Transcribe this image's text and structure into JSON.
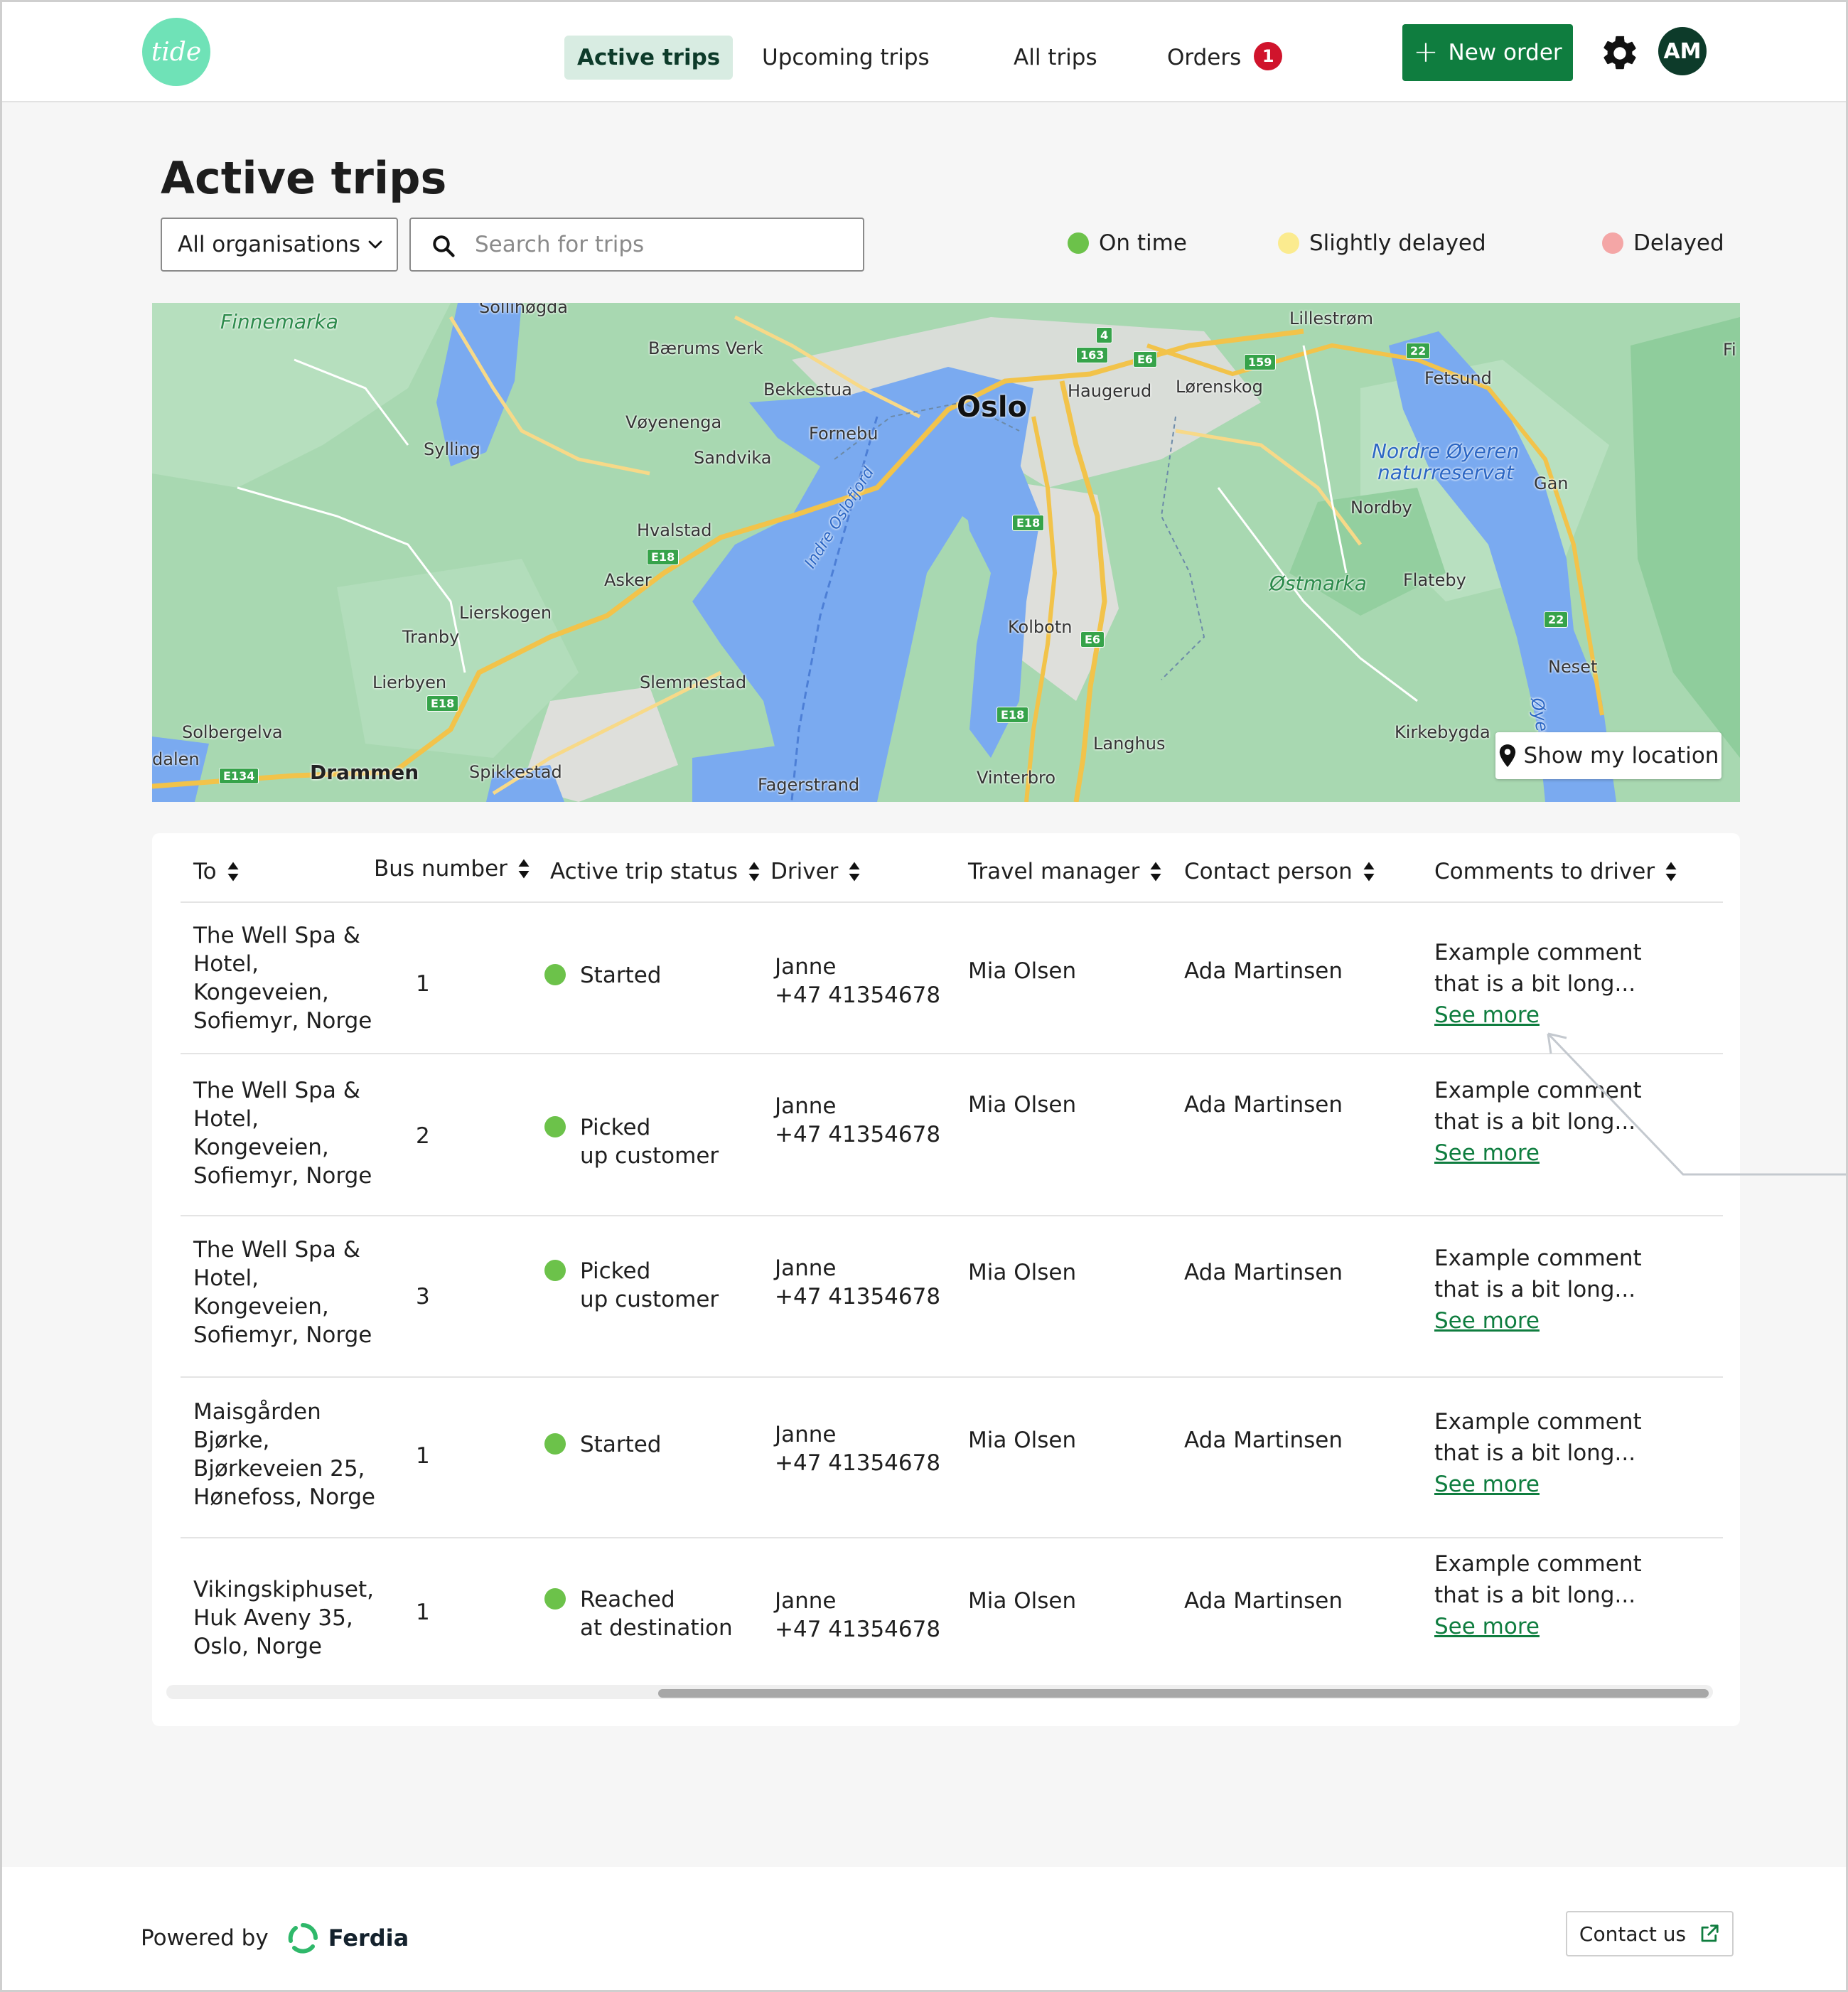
{
  "app": {
    "logo_text": "tide"
  },
  "nav": {
    "active_trips": "Active trips",
    "upcoming_trips": "Upcoming trips",
    "all_trips": "All trips",
    "orders": "Orders",
    "orders_badge": "1"
  },
  "header": {
    "new_order": "New order",
    "avatar_initials": "AM"
  },
  "page": {
    "title": "Active trips"
  },
  "filters": {
    "organisation_selected": "All organisations",
    "search_placeholder": "Search for trips"
  },
  "legend": {
    "on_time": "On time",
    "slightly_delayed": "Slightly delayed",
    "delayed": "Delayed",
    "colors": {
      "on_time": "#6cc24a",
      "slightly_delayed": "#fbeb8f",
      "delayed": "#f4a6a6"
    }
  },
  "map": {
    "show_location": "Show my location",
    "labels": {
      "finnemarka": "Finnemarka",
      "sollihogda": "Sollihøgda",
      "baerums_verk": "Bærums Verk",
      "lillestrom": "Lillestrøm",
      "fetsund": "Fetsund",
      "bekkestua": "Bekkestua",
      "oslo": "Oslo",
      "haugerud": "Haugerud",
      "lorenskog": "Lørenskog",
      "voyenenga": "Vøyenenga",
      "fornebu": "Fornebu",
      "sylling": "Sylling",
      "sandvika": "Sandvika",
      "nordre_oyeren": "Nordre Øyeren",
      "naturreservat": "naturreservat",
      "gan": "Gan",
      "nordby": "Nordby",
      "hvalstad": "Hvalstad",
      "indre_oslofjord": "Indre Oslofjord",
      "asker": "Asker",
      "ostmarka": "Østmarka",
      "flateby": "Flateby",
      "lierskogen": "Lierskogen",
      "tranby": "Tranby",
      "kolbotn": "Kolbotn",
      "neset": "Neset",
      "slemmestad": "Slemmestad",
      "lierbyen": "Lierbyen",
      "solbergelva": "Solbergelva",
      "kirkebygda": "Kirkebygda",
      "langhus": "Langhus",
      "dalen": "dalen",
      "drammen": "Drammen",
      "spikkestad": "Spikkestad",
      "fagerstrand": "Fagerstrand",
      "vinterbro": "Vinterbro",
      "oyeren": "Øyer",
      "fi": "Fi"
    },
    "shields": {
      "r4": "4",
      "r163": "163",
      "e6a": "E6",
      "r159": "159",
      "r22a": "22",
      "e18a": "E18",
      "e18b": "E18",
      "e18c": "E18",
      "e18d": "E18",
      "e6b": "E6",
      "r22b": "22",
      "e134": "E134"
    }
  },
  "table": {
    "headers": {
      "to": "To",
      "bus_number": "Bus number",
      "status": "Active trip status",
      "driver": "Driver",
      "travel_manager": "Travel manager",
      "contact_person": "Contact person",
      "comments": "Comments to driver"
    },
    "rows": [
      {
        "to": [
          "The Well Spa &",
          "Hotel,",
          "Kongeveien,",
          "Sofiemyr, Norge"
        ],
        "bus": "1",
        "status": [
          "Started"
        ],
        "driver_name": "Janne",
        "driver_phone": "+47 41354678",
        "travel_manager": "Mia Olsen",
        "contact_person": "Ada Martinsen",
        "comment": [
          "Example comment",
          "that is a bit long..."
        ],
        "see_more": "See more"
      },
      {
        "to": [
          "The Well Spa &",
          "Hotel,",
          "Kongeveien,",
          "Sofiemyr, Norge"
        ],
        "bus": "2",
        "status": [
          "Picked",
          "up customer"
        ],
        "driver_name": "Janne",
        "driver_phone": "+47 41354678",
        "travel_manager": "Mia Olsen",
        "contact_person": "Ada Martinsen",
        "comment": [
          "Example comment",
          "that is a bit long..."
        ],
        "see_more": "See more"
      },
      {
        "to": [
          "The Well Spa &",
          "Hotel,",
          "Kongeveien,",
          "Sofiemyr, Norge"
        ],
        "bus": "3",
        "status": [
          "Picked",
          "up customer"
        ],
        "driver_name": "Janne",
        "driver_phone": "+47 41354678",
        "travel_manager": "Mia Olsen",
        "contact_person": "Ada Martinsen",
        "comment": [
          "Example comment",
          "that is a bit long..."
        ],
        "see_more": "See more"
      },
      {
        "to": [
          "Maisgården",
          "Bjørke,",
          "Bjørkeveien 25,",
          "Hønefoss, Norge"
        ],
        "bus": "1",
        "status": [
          "Started"
        ],
        "driver_name": "Janne",
        "driver_phone": "+47 41354678",
        "travel_manager": "Mia Olsen",
        "contact_person": "Ada Martinsen",
        "comment": [
          "Example comment",
          "that is a bit long..."
        ],
        "see_more": "See more"
      },
      {
        "to": [
          "Vikingskiphuset,",
          "Huk Aveny 35,",
          "Oslo, Norge"
        ],
        "bus": "1",
        "status": [
          "Reached",
          "at destination"
        ],
        "driver_name": "Janne",
        "driver_phone": "+47 41354678",
        "travel_manager": "Mia Olsen",
        "contact_person": "Ada Martinsen",
        "comment": [
          "Example comment",
          "that is a bit long..."
        ],
        "see_more": "See more"
      }
    ]
  },
  "footer": {
    "powered_by": "Powered by",
    "brand": "Ferdia",
    "contact_us": "Contact us"
  },
  "colors": {
    "primary_green": "#0f7d3f",
    "status_green": "#6cc24a",
    "badge_red": "#d0142c",
    "nav_active_bg": "#d8ece2",
    "logo_mint": "#6fe2b7"
  }
}
